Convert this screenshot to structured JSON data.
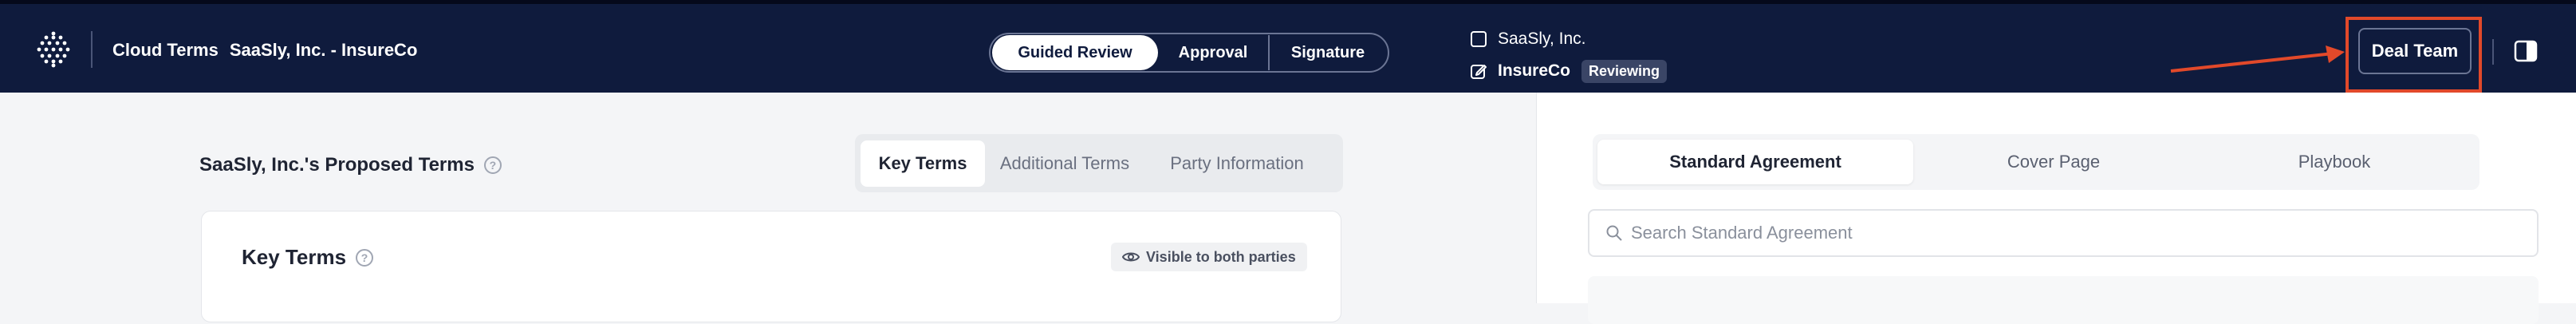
{
  "header": {
    "app_name": "Cloud Terms",
    "deal_name": "SaaSly, Inc. - InsureCo",
    "modes": [
      {
        "label": "Guided Review",
        "active": true
      },
      {
        "label": "Approval",
        "active": false
      },
      {
        "label": "Signature",
        "active": false
      }
    ],
    "parties": [
      {
        "name": "SaaSly, Inc.",
        "icon": "square-icon"
      },
      {
        "name": "InsureCo",
        "icon": "edit-icon",
        "status": "Reviewing"
      }
    ],
    "deal_team_label": "Deal Team",
    "annotation_color": "#e2492a"
  },
  "left": {
    "title": "SaaSly, Inc.'s Proposed Terms",
    "help_glyph": "?",
    "tabs": [
      {
        "label": "Key Terms",
        "active": true
      },
      {
        "label": "Additional Terms",
        "active": false
      },
      {
        "label": "Party Information",
        "active": false
      }
    ],
    "card": {
      "title": "Key Terms",
      "help_glyph": "?",
      "visibility_label": "Visible to both parties"
    }
  },
  "right": {
    "tabs": [
      {
        "label": "Standard Agreement",
        "active": true
      },
      {
        "label": "Cover Page",
        "active": false
      },
      {
        "label": "Playbook",
        "active": false
      }
    ],
    "search_placeholder": "Search Standard Agreement"
  },
  "colors": {
    "header_bg": "#0f1b3d",
    "accent_highlight": "#e2492a"
  }
}
